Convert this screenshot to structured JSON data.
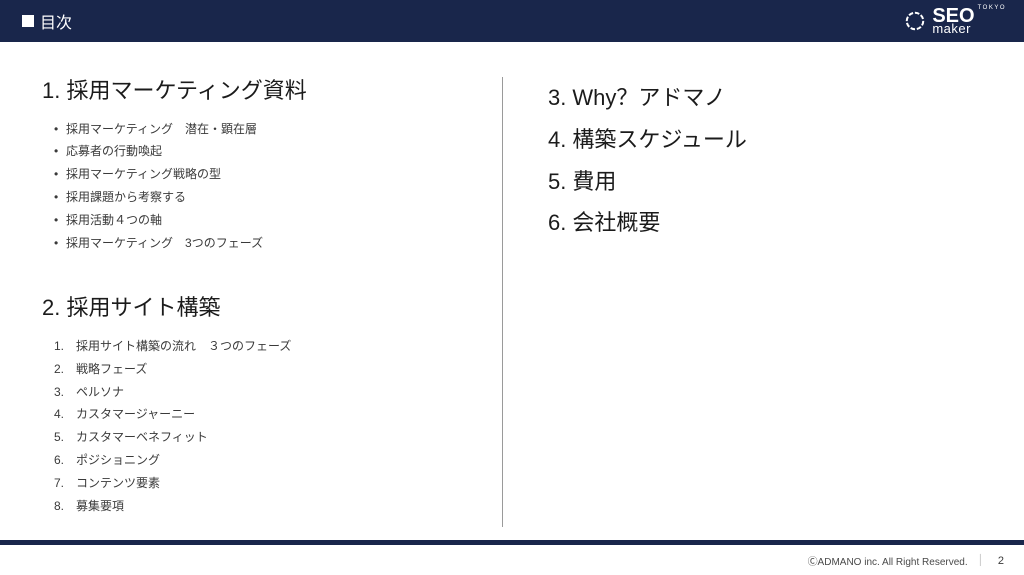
{
  "header": {
    "title": "目次",
    "logo": {
      "main": "SEO",
      "sub": "maker",
      "tokyo": "TOKYO"
    }
  },
  "left": {
    "section1": {
      "num": "1.",
      "title": "採用マーケティング資料",
      "items": [
        "採用マーケティング　潜在・顕在層",
        "応募者の行動喚起",
        "採用マーケティング戦略の型",
        "採用課題から考察する",
        "採用活動４つの軸",
        "採用マーケティング　3つのフェーズ"
      ]
    },
    "section2": {
      "num": "2.",
      "title": "採用サイト構築",
      "items": [
        {
          "n": "1.",
          "t": "採用サイト構築の流れ　３つのフェーズ"
        },
        {
          "n": "2.",
          "t": "戦略フェーズ"
        },
        {
          "n": "3.",
          "t": "ペルソナ"
        },
        {
          "n": "4.",
          "t": "カスタマージャーニー"
        },
        {
          "n": "5.",
          "t": "カスタマーベネフィット"
        },
        {
          "n": "6.",
          "t": "ポジショニング"
        },
        {
          "n": "7.",
          "t": "コンテンツ要素"
        },
        {
          "n": "8.",
          "t": "募集要項"
        }
      ]
    }
  },
  "right": {
    "items": [
      {
        "n": "3.",
        "t": "Why？アドマノ"
      },
      {
        "n": "4.",
        "t": "構築スケジュール"
      },
      {
        "n": "5.",
        "t": "費用"
      },
      {
        "n": "6.",
        "t": "会社概要"
      }
    ]
  },
  "footer": {
    "copyright": "ⒸADMANO inc. All Right Reserved.",
    "page": "2"
  }
}
